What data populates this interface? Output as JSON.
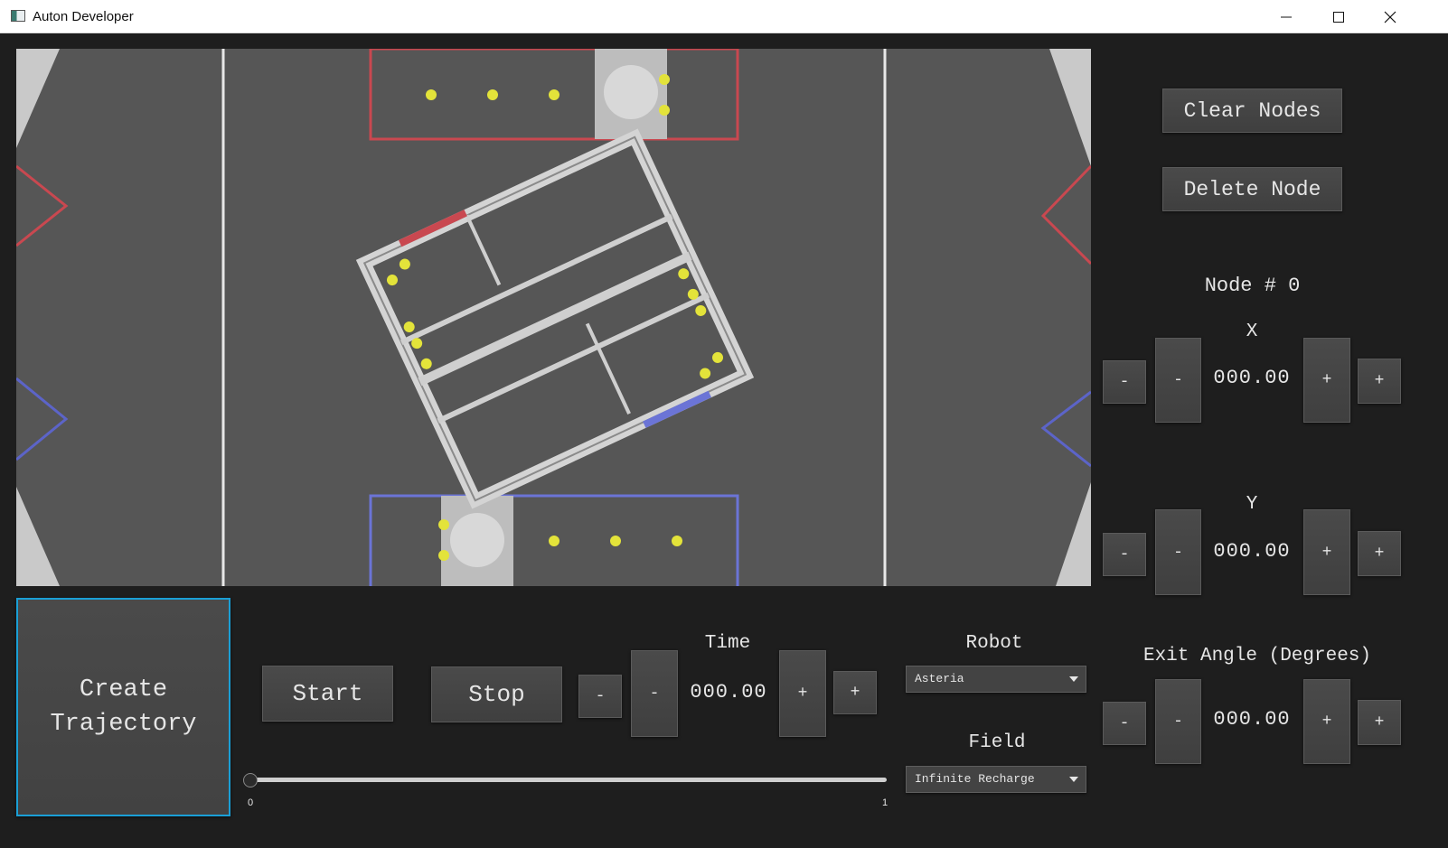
{
  "window": {
    "title": "Auton Developer"
  },
  "field": {
    "image": "field-map"
  },
  "buttons": {
    "create_trajectory": "Create\nTrajectory",
    "start": "Start",
    "stop": "Stop",
    "clear_nodes": "Clear Nodes",
    "delete_node": "Delete Node"
  },
  "time": {
    "label": "Time",
    "value": "000.00",
    "minus": "-",
    "plus": "+"
  },
  "slider": {
    "min_label": "0",
    "max_label": "1",
    "value": 0
  },
  "robot": {
    "label": "Robot",
    "selected": "Asteria"
  },
  "field_select": {
    "label": "Field",
    "selected": "Infinite Recharge"
  },
  "node": {
    "title": "Node # 0",
    "x": {
      "label": "X",
      "value": "000.00",
      "minus": "-",
      "plus": "+"
    },
    "y": {
      "label": "Y",
      "value": "000.00",
      "minus": "-",
      "plus": "+"
    },
    "angle": {
      "label": "Exit Angle (Degrees)",
      "value": "000.00",
      "minus": "-",
      "plus": "+"
    }
  },
  "colors": {
    "accent": "#1a9fd6",
    "background": "#1e1e1e",
    "red_alliance": "#d9484e",
    "blue_alliance": "#6b74d6",
    "ball": "#e6e63a"
  }
}
